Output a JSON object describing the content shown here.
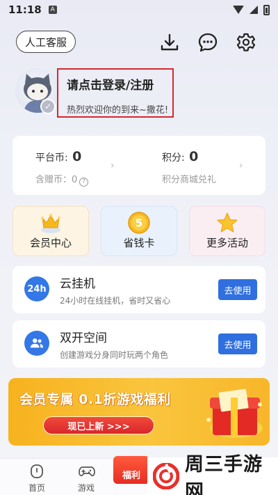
{
  "status_bar": {
    "time": "11:18",
    "app_indicator": "A"
  },
  "header": {
    "service_button": "人工客服",
    "icons": [
      "download-icon",
      "chat-icon",
      "settings-icon"
    ]
  },
  "profile": {
    "login_title": "请点击登录/注册",
    "welcome": "热烈欢迎你的到来~撒花!"
  },
  "wallet": {
    "platform_coin_label": "平台币:",
    "platform_coin_value": "0",
    "gift_coin_label": "含赠币：",
    "gift_coin_value": "0",
    "points_label": "积分:",
    "points_value": "0",
    "points_link": "积分商城兑礼"
  },
  "features": [
    {
      "label": "会员中心",
      "icon": "crown-icon"
    },
    {
      "label": "省钱卡",
      "icon": "coin-icon",
      "coin_text": "5"
    },
    {
      "label": "更多活动",
      "icon": "star-icon"
    }
  ],
  "services": [
    {
      "title": "云挂机",
      "desc": "24小时在线挂机，省时又省心",
      "button": "去使用",
      "icon_text": "24h"
    },
    {
      "title": "双开空间",
      "desc": "创建游戏分身同时玩两个角色",
      "button": "去使用",
      "icon": "users-icon"
    }
  ],
  "banner": {
    "title": "会员专属 0.1折游戏福利",
    "button": "现已上新 >>>"
  },
  "tabbar": {
    "tabs": [
      {
        "label": "首页",
        "icon": "home-icon"
      },
      {
        "label": "游戏",
        "icon": "gamepad-icon"
      }
    ],
    "welfare_label": "福利"
  },
  "watermark": {
    "text": "周三手游网"
  },
  "colors": {
    "accent_blue": "#2f6fe0",
    "highlight_red": "#d9262c",
    "banner_yellow": "#f7b21f"
  }
}
